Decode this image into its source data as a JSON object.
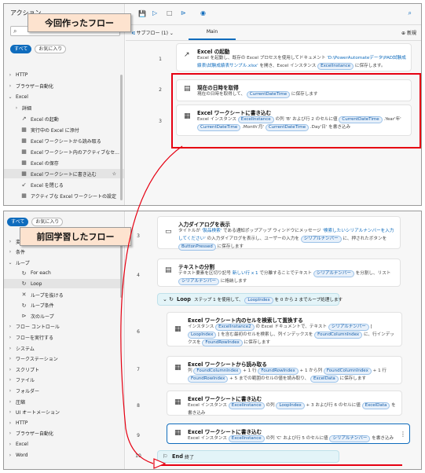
{
  "callouts": {
    "top": "今回作ったフロー",
    "bottom": "前回学習したフロー"
  },
  "p1": {
    "title": "アクション",
    "filters": [
      "すべて",
      "お気に入り"
    ],
    "tree": [
      {
        "label": "HTTP",
        "chev": "›",
        "indent": 1
      },
      {
        "label": "ブラウザー自動化",
        "chev": "›",
        "indent": 1
      },
      {
        "label": "Excel",
        "chev": "⌄",
        "indent": 1
      },
      {
        "label": "詳細",
        "chev": "›",
        "indent": 2
      },
      {
        "label": "Excel の起動",
        "icon": "↗",
        "indent": 3
      },
      {
        "label": "実行中の Excel に添付",
        "icon": "▦",
        "indent": 3
      },
      {
        "label": "Excel ワークシートから読み取る",
        "icon": "▦",
        "indent": 3
      },
      {
        "label": "Excel ワークシート内のアクティブなセ...",
        "icon": "▦",
        "indent": 3
      },
      {
        "label": "Excel の保存",
        "icon": "▦",
        "indent": 3
      },
      {
        "label": "Excel ワークシートに書き込む",
        "icon": "▦",
        "indent": 3,
        "selected": true
      },
      {
        "label": "Excel を閉じる",
        "icon": "↙",
        "indent": 3
      },
      {
        "label": "アクティブな Excel ワークシートの設定",
        "icon": "▦",
        "indent": 3
      }
    ],
    "subflow_label": "サブフロー (1)",
    "tab_main": "Main",
    "new_label": "新規",
    "steps": [
      {
        "num": "1",
        "title": "Excel の起動",
        "desc": "Excel を起動し、既存の Excel プロセスを使用してドキュメント 'D:\\PowerAutomateデータ\\PAD試験成績表\\試験成績表サンプル.xlsx' を開き、Excel インスタンス ExcelInstance に保存します。"
      },
      {
        "num": "2",
        "title": "現在の日時を取得",
        "desc": "現在の日時を取得して、 CurrentDateTime に保存します"
      },
      {
        "num": "3",
        "title": "Excel ワークシートに書き込む",
        "desc": "Excel インスタンス ExcelInstance の列 'B' および行 2 のセルに値 CurrentDateTime .Year'年' CurrentDateTime .Month'月' CurrentDateTime .Day'日' を書き込み"
      }
    ]
  },
  "p2": {
    "filters": [
      "すべて",
      "お気に入り"
    ],
    "tree": [
      {
        "label": "変数",
        "chev": "›",
        "indent": 1
      },
      {
        "label": "条件",
        "chev": "›",
        "indent": 1
      },
      {
        "label": "ループ",
        "chev": "⌄",
        "indent": 1
      },
      {
        "label": "For each",
        "icon": "↻",
        "indent": 3
      },
      {
        "label": "Loop",
        "icon": "↻",
        "indent": 3,
        "selected": true
      },
      {
        "label": "ループを抜ける",
        "icon": "✕",
        "indent": 3
      },
      {
        "label": "ループ条件",
        "icon": "↻",
        "indent": 3
      },
      {
        "label": "次のループ",
        "icon": "⊳",
        "indent": 3
      },
      {
        "label": "フロー コントロール",
        "chev": "›",
        "indent": 1
      },
      {
        "label": "フローを実行する",
        "chev": "›",
        "indent": 1
      },
      {
        "label": "システム",
        "chev": "›",
        "indent": 1
      },
      {
        "label": "ワークステーション",
        "chev": "›",
        "indent": 1
      },
      {
        "label": "スクリプト",
        "chev": "›",
        "indent": 1
      },
      {
        "label": "ファイル",
        "chev": "›",
        "indent": 1
      },
      {
        "label": "フォルダー",
        "chev": "›",
        "indent": 1
      },
      {
        "label": "圧縮",
        "chev": "›",
        "indent": 1
      },
      {
        "label": "UI オートメーション",
        "chev": "›",
        "indent": 1
      },
      {
        "label": "HTTP",
        "chev": "›",
        "indent": 1
      },
      {
        "label": "ブラウザー自動化",
        "chev": "›",
        "indent": 1
      },
      {
        "label": "Excel",
        "chev": "›",
        "indent": 1
      },
      {
        "label": "Word",
        "chev": "›",
        "indent": 1
      }
    ],
    "steps": [
      {
        "num": "3",
        "title": "入力ダイアログを表示",
        "desc": "タイトルが '製品検索' である通知ポップアップ ウィンドウにメッセージ '検索したいシリアルナンバーを入力してください' の入力ダイアログを表示し、ユーザーの入力を シリアルナンバー に、押されたボタンを ButtonPressed に保存します"
      },
      {
        "num": "4",
        "title": "テキストの分割",
        "desc": "テキスト要素を区切り記号 新しい行 x 1 で分離することでテキスト シリアルナンバー を分割し、リスト シリアルナンバー に格納します"
      },
      {
        "num": "5",
        "title": "Loop",
        "desc": "ステップ 1 を使用して、 LoopIndex を 0 から 2 までループ処理します"
      },
      {
        "num": "6",
        "title": "Excel ワークシート内のセルを検索して置換する",
        "desc": "インスタンス ExcelInstance2 の Excel ドキュメントで、テキスト シリアルナンバー [ LoopIndex ] を含む最初のセルを検索し、列インデックスを FoundColumnIndex に、行インデックスを FoundRowIndex に保存します"
      },
      {
        "num": "7",
        "title": "Excel ワークシートから読み取る",
        "desc": "列 FoundColumnIndex + 1 行 FoundRowIndex + 1 から列 FoundColumnIndex + 1 行 FoundRowIndex + 5 までの範囲のセルの値を読み取り、 ExcelData に保存します"
      },
      {
        "num": "8",
        "title": "Excel ワークシートに書き込む",
        "desc": "Excel インスタンス ExcelInstance の列 LoopIndex + 3 および行 6 のセルに値 ExcelData を書き込み"
      },
      {
        "num": "9",
        "title": "Excel ワークシートに書き込む",
        "desc": "Excel インスタンス ExcelInstance の列 'C' および行 5 のセルに値 シリアルナンバー を書き込み"
      },
      {
        "num": "10",
        "title": "End",
        "desc": "終了"
      }
    ]
  }
}
